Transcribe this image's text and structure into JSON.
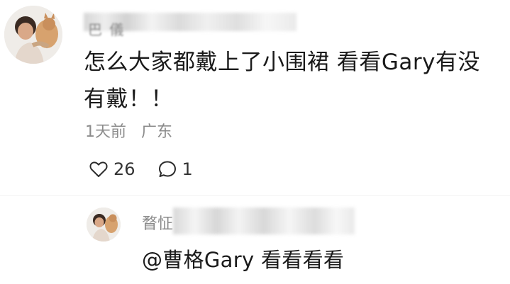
{
  "comment": {
    "username_partial": "巴 儀",
    "text": "怎么大家都戴上了小围裙 看看Gary有没有戴！！",
    "time": "1天前",
    "location": "广东",
    "likes": "26",
    "replies": "1"
  },
  "reply": {
    "username_partial": "瞀怔",
    "mention": "@曹格Gary",
    "text": "看看看看"
  },
  "icons": {
    "like": "heart-outline-icon",
    "reply": "speech-bubble-outline-icon"
  }
}
